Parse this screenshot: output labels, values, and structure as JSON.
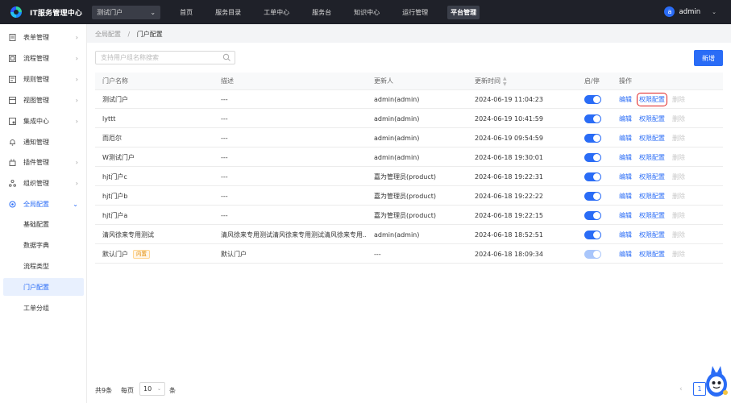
{
  "header": {
    "brand": "IT服务管理中心",
    "portal": "测试门户",
    "nav": [
      "首页",
      "服务目录",
      "工单中心",
      "服务台",
      "知识中心",
      "运行管理",
      "平台管理"
    ],
    "active_nav": "平台管理",
    "user_initial": "a",
    "user_name": "admin"
  },
  "sidebar": {
    "items": [
      {
        "label": "表单管理",
        "icon": "form-icon"
      },
      {
        "label": "流程管理",
        "icon": "flow-icon"
      },
      {
        "label": "规则管理",
        "icon": "rule-icon"
      },
      {
        "label": "视图管理",
        "icon": "view-icon"
      },
      {
        "label": "集成中心",
        "icon": "integration-icon"
      },
      {
        "label": "通知管理",
        "icon": "bell-icon"
      },
      {
        "label": "插件管理",
        "icon": "plugin-icon"
      },
      {
        "label": "组织管理",
        "icon": "org-icon"
      },
      {
        "label": "全局配置",
        "icon": "settings-icon"
      }
    ],
    "sub_items": [
      "基础配置",
      "数据字典",
      "流程类型",
      "门户配置",
      "工单分组"
    ],
    "active_sub": "门户配置"
  },
  "breadcrumb": {
    "parent": "全局配置",
    "separator": "/",
    "current": "门户配置"
  },
  "toolbar": {
    "search_placeholder": "支持用户组名称搜索",
    "add_label": "新增"
  },
  "table": {
    "columns": [
      "门户名称",
      "描述",
      "更新人",
      "更新时间",
      "启/停",
      "操作"
    ],
    "ops": [
      "编辑",
      "权限配置",
      "删除"
    ],
    "rows": [
      {
        "name": "测试门户",
        "tag": "",
        "desc": "---",
        "updater": "admin(admin)",
        "time": "2024-06-19 11:04:23",
        "enabled": true
      },
      {
        "name": "lyttt",
        "tag": "",
        "desc": "---",
        "updater": "admin(admin)",
        "time": "2024-06-19 10:41:59",
        "enabled": true
      },
      {
        "name": "而厄尔",
        "tag": "",
        "desc": "---",
        "updater": "admin(admin)",
        "time": "2024-06-19 09:54:59",
        "enabled": true
      },
      {
        "name": "W测试门户",
        "tag": "",
        "desc": "---",
        "updater": "admin(admin)",
        "time": "2024-06-18 19:30:01",
        "enabled": true
      },
      {
        "name": "hjt门户c",
        "tag": "",
        "desc": "---",
        "updater": "嘉为管理员(product)",
        "time": "2024-06-18 19:22:31",
        "enabled": true
      },
      {
        "name": "hjt门户b",
        "tag": "",
        "desc": "---",
        "updater": "嘉为管理员(product)",
        "time": "2024-06-18 19:22:22",
        "enabled": true
      },
      {
        "name": "hjt门户a",
        "tag": "",
        "desc": "---",
        "updater": "嘉为管理员(product)",
        "time": "2024-06-18 19:22:15",
        "enabled": true
      },
      {
        "name": "清风徐来专用测试",
        "tag": "",
        "desc": "清风徐来专用测试清风徐来专用测试清风徐来专用...",
        "updater": "admin(admin)",
        "time": "2024-06-18 18:52:51",
        "enabled": true
      },
      {
        "name": "默认门户",
        "tag": "内置",
        "desc": "默认门户",
        "updater": "---",
        "time": "2024-06-18 18:09:34",
        "enabled": true
      }
    ]
  },
  "pagination": {
    "total": "共9条",
    "per_page_label": "每页",
    "page_size": "10",
    "unit": "条",
    "current_page": "1"
  },
  "colors": {
    "primary": "#2a6cf6",
    "topbar": "#1f2129",
    "highlight": "#e02020"
  }
}
